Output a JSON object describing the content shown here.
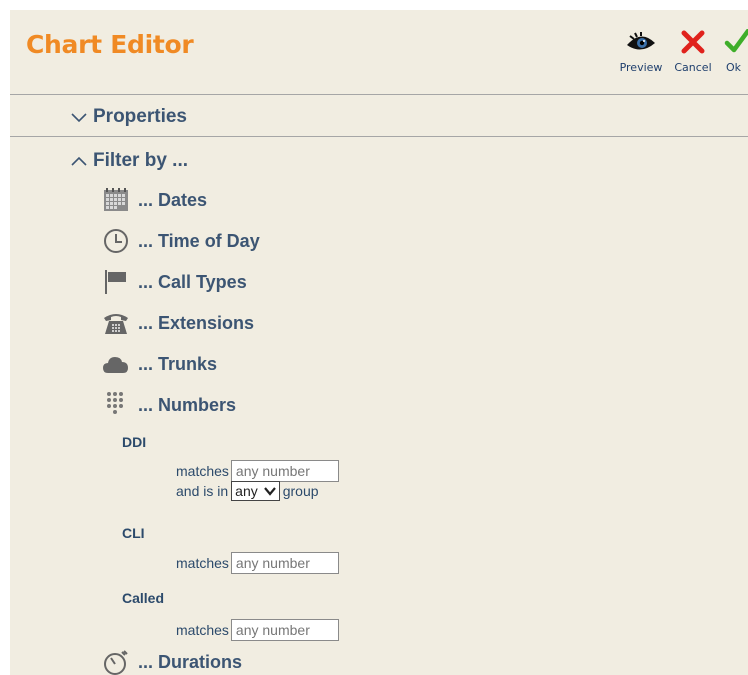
{
  "header": {
    "title": "Chart Editor",
    "buttons": [
      {
        "label": "Preview",
        "icon": "eye-icon"
      },
      {
        "label": "Cancel",
        "icon": "red-x-icon"
      },
      {
        "label": "Ok",
        "icon": "green-check-icon"
      }
    ]
  },
  "sections": {
    "properties": "Properties",
    "filter_by": "Filter by ..."
  },
  "filters": [
    {
      "label": "... Dates",
      "icon": "calendar-icon"
    },
    {
      "label": "... Time of Day",
      "icon": "clock-icon"
    },
    {
      "label": "... Call Types",
      "icon": "flag-icon"
    },
    {
      "label": "... Extensions",
      "icon": "telephone-icon"
    },
    {
      "label": "... Trunks",
      "icon": "cloud-icon"
    },
    {
      "label": "... Numbers",
      "icon": "keypad-icon"
    },
    {
      "label": "... Durations",
      "icon": "stopwatch-icon"
    }
  ],
  "numbers": {
    "ddi": {
      "label": "DDI",
      "matches_label": "matches",
      "placeholder": "any number",
      "group_prefix": "and is in",
      "group_value": "any",
      "group_suffix": "group"
    },
    "cli": {
      "label": "CLI",
      "matches_label": "matches",
      "placeholder": "any number"
    },
    "called": {
      "label": "Called",
      "matches_label": "matches",
      "placeholder": "any number"
    }
  },
  "colors": {
    "title": "#f08a24",
    "label": "#3c5573",
    "background": "#f1ede1"
  }
}
